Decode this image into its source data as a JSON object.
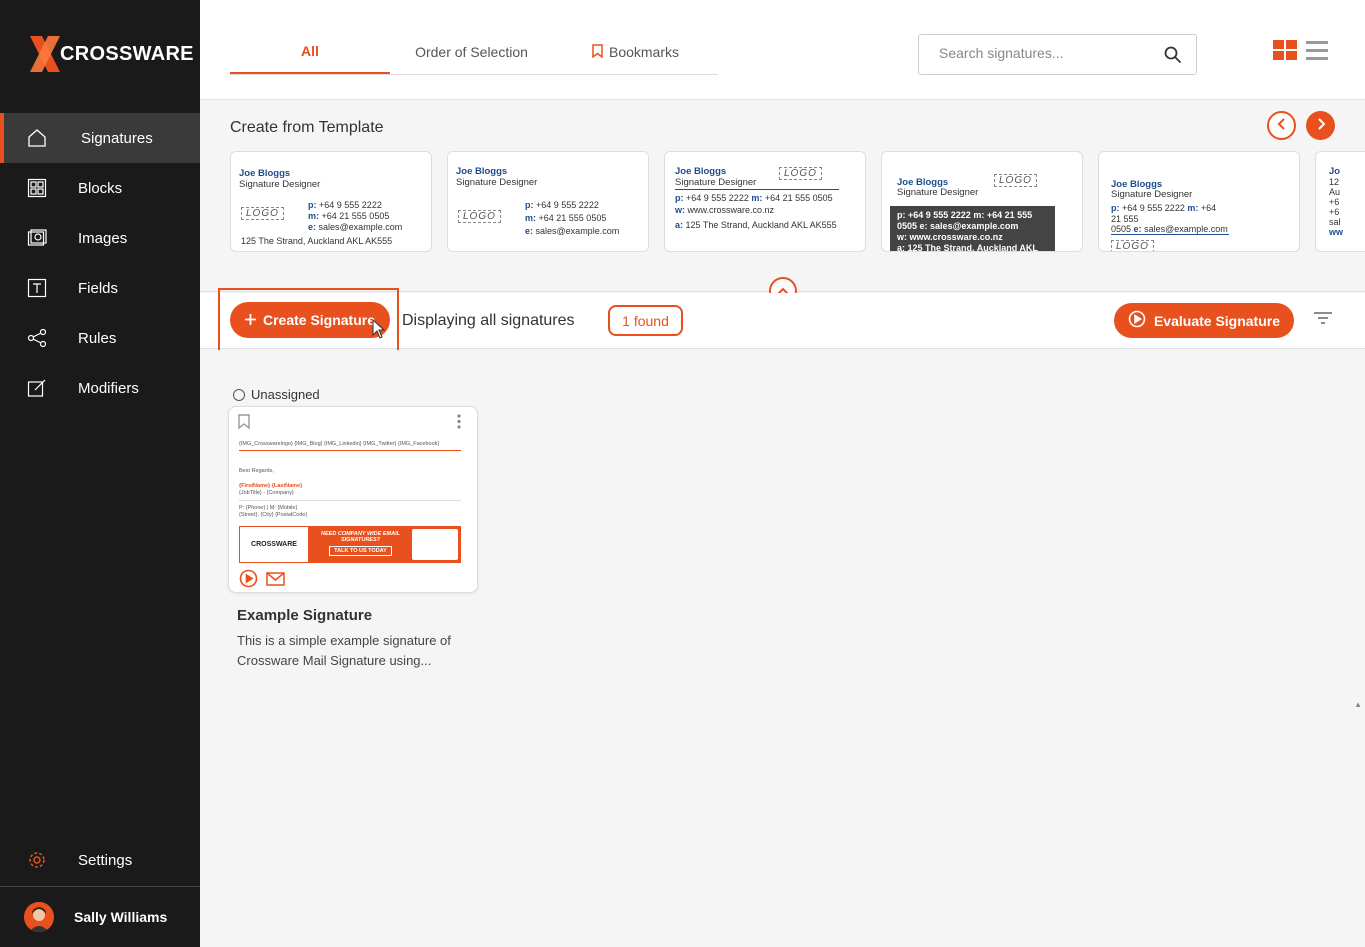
{
  "brand": {
    "name": "CROSSWARE",
    "accent": "#e8501e"
  },
  "sidebar": {
    "items": [
      {
        "label": "Signatures",
        "icon": "home-icon",
        "active": true
      },
      {
        "label": "Blocks",
        "icon": "blocks-icon"
      },
      {
        "label": "Images",
        "icon": "images-icon"
      },
      {
        "label": "Fields",
        "icon": "fields-icon"
      },
      {
        "label": "Rules",
        "icon": "rules-icon"
      },
      {
        "label": "Modifiers",
        "icon": "modifiers-icon"
      }
    ],
    "settings": "Settings",
    "user": "Sally Williams"
  },
  "tabs": [
    {
      "label": "All",
      "active": true
    },
    {
      "label": "Order of Selection"
    },
    {
      "label": "Bookmarks"
    }
  ],
  "search": {
    "placeholder": "Search signatures..."
  },
  "templates": {
    "title": "Create from Template",
    "cards": [
      {
        "name": "Joe Bloggs",
        "role": "Signature Designer",
        "phone": "+64 9 555 2222",
        "mobile": "+64 21 555 0505",
        "email": "sales@example.com",
        "address": "125 The Strand, Auckland AKL AK555",
        "logo": "LOGO"
      },
      {
        "name": "Joe Bloggs",
        "role": "Signature Designer",
        "phone": "+64 9 555 2222",
        "mobile": "+64 21 555 0505",
        "email": "sales@example.com",
        "logo": "LOGO"
      },
      {
        "name": "Joe Bloggs",
        "role": "Signature Designer",
        "line1": "+64 9 555 2222",
        "line1b": "+64 21 555 0505",
        "web": "www.crossware.co.nz",
        "address": "125 The Strand, Auckland AKL AK555",
        "logo": "LOGO"
      },
      {
        "name": "Joe Bloggs",
        "role": "Signature Designer",
        "line1": "+64 9 555 2222",
        "line1b": "+64 21 555",
        "line2": "0505",
        "email": "sales@example.com",
        "web": "www.crossware.co.nz",
        "address": "125 The Strand, Auckland AKL",
        "logo": "LOGO"
      },
      {
        "name": "Joe Bloggs",
        "role": "Signature Designer",
        "line1": "+64 9 555 2222",
        "line1b": "+64",
        "line2": "21 555",
        "line3": "0505",
        "email": "sales@example.com",
        "logo": "LOGO"
      },
      {
        "name": "Jo",
        "l1": "12",
        "l2": "Au",
        "l3": "+6",
        "l4": "+6",
        "l5": "sal",
        "l6": "ww"
      }
    ]
  },
  "actions": {
    "create": "Create Signature",
    "display": "Displaying all signatures",
    "found": "1 found",
    "evaluate": "Evaluate Signature"
  },
  "signatures": [
    {
      "status": "Unassigned",
      "title": "Example Signature",
      "description": "This is a simple example signature of Crossware Mail Signature using...",
      "preview": {
        "images": "{IMG_Crosswarelogo} {IMG_Blog} {IMG_Linkedin} {IMG_Twitter} {IMG_Facebook}",
        "greeting": "Best Regards,",
        "name": "{FirstName} {LastName}",
        "job": "{JobTitle} - {Company}",
        "phones": "P: {Phone} | M: {Mobile}",
        "address": "{Street}, {City} {PostalCode}",
        "banner_logo": "CROSSWARE",
        "banner_text": "NEED COMPANY WIDE EMAIL SIGNATURES?",
        "banner_cta": "TALK TO US TODAY"
      }
    }
  ]
}
